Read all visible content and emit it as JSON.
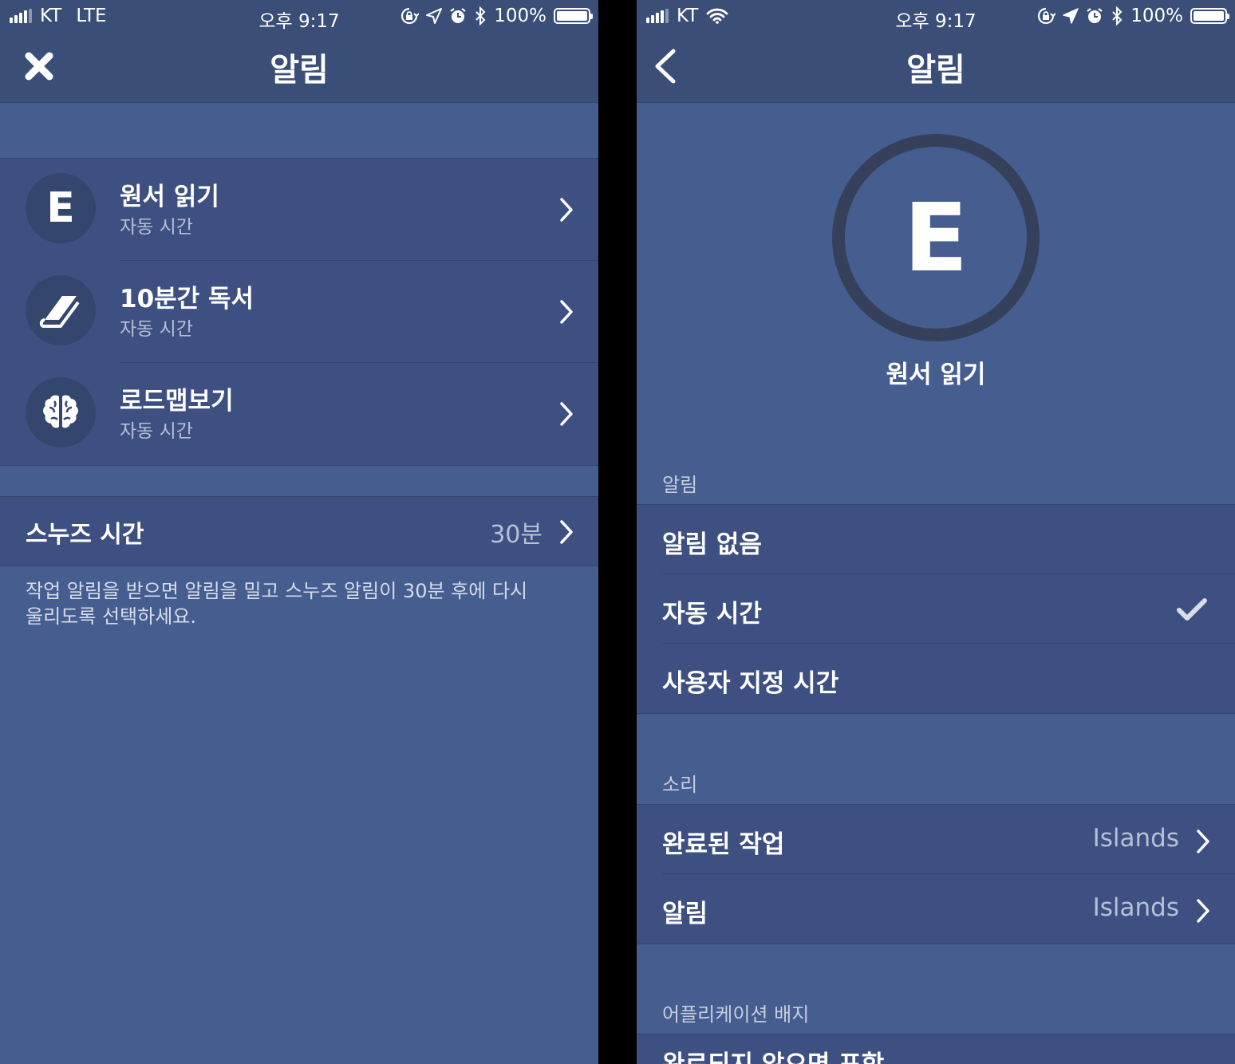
{
  "colors": {
    "background": "#465d8f",
    "bar": "#3b4e77",
    "row": "#3d5081",
    "icon_circle": "#34466e",
    "secondary_text": "#b6c0d6"
  },
  "left": {
    "status": {
      "carrier": "KT",
      "network": "LTE",
      "time": "오후 9:17",
      "battery": "100%",
      "battery_level": 1.0,
      "icons": [
        "rotation-lock-icon",
        "location-icon",
        "alarm-icon",
        "bluetooth-icon"
      ]
    },
    "nav": {
      "title": "알림",
      "close_icon": "close-icon"
    },
    "tasks": [
      {
        "icon": "letter-e-icon",
        "icon_text": "E",
        "title": "원서 읽기",
        "subtitle": "자동 시간"
      },
      {
        "icon": "book-icon",
        "title": "10분간 독서",
        "subtitle": "자동 시간"
      },
      {
        "icon": "brain-icon",
        "title": "로드맵보기",
        "subtitle": "자동 시간"
      }
    ],
    "snooze": {
      "label": "스누즈 시간",
      "value": "30분"
    },
    "note": "작업 알림을 받으면 알림을 밀고 스누즈 알림이 30분 후에 다시 울리도록 선택하세요."
  },
  "right": {
    "status": {
      "carrier": "KT",
      "time": "오후 9:17",
      "battery": "100%",
      "battery_level": 1.0,
      "icons": [
        "wifi-icon",
        "rotation-lock-icon",
        "location-icon",
        "alarm-icon",
        "bluetooth-icon"
      ]
    },
    "nav": {
      "title": "알림",
      "back_icon": "chevron-left-icon"
    },
    "task": {
      "icon_text": "E",
      "name": "원서 읽기"
    },
    "alarm_section": {
      "header": "알림",
      "options": [
        {
          "label": "알림 없음",
          "selected": false
        },
        {
          "label": "자동 시간",
          "selected": true
        },
        {
          "label": "사용자 지정 시간",
          "selected": false
        }
      ]
    },
    "sound_section": {
      "header": "소리",
      "items": [
        {
          "label": "완료된 작업",
          "value": "Islands"
        },
        {
          "label": "알림",
          "value": "Islands"
        }
      ]
    },
    "badge_section": {
      "header": "어플리케이션 배지",
      "first_item": "완료되지 않으면 포함"
    }
  }
}
